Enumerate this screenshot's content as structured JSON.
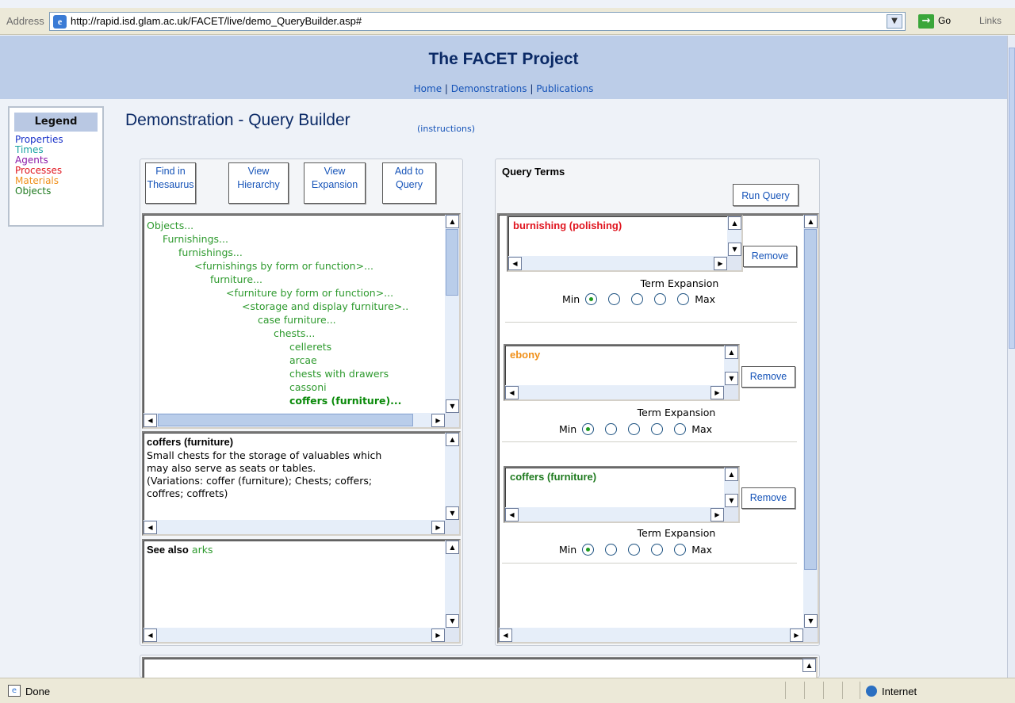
{
  "browser": {
    "address_label": "Address",
    "url": "http://rapid.isd.glam.ac.uk/FACET/live/demo_QueryBuilder.asp#",
    "go_label": "Go",
    "links_label": "Links",
    "status_text": "Done",
    "zone_text": "Internet"
  },
  "header": {
    "title": "The FACET Project",
    "nav": [
      "Home",
      "Demonstrations",
      "Publications"
    ],
    "separator": "|"
  },
  "legend": {
    "title": "Legend",
    "items": [
      {
        "label": "Properties",
        "color": "#1a33c9"
      },
      {
        "label": "Times",
        "color": "#19a3a3"
      },
      {
        "label": "Agents",
        "color": "#8a1aa8"
      },
      {
        "label": "Processes",
        "color": "#e0151f"
      },
      {
        "label": "Materials",
        "color": "#f0901a"
      },
      {
        "label": "Objects",
        "color": "#1f7a1f"
      }
    ]
  },
  "page": {
    "title": "Demonstration - Query Builder",
    "instructions_link": "(instructions)"
  },
  "toolbar": {
    "buttons": [
      {
        "line1": "Find in",
        "line2": "Thesaurus"
      },
      {
        "line1": "View",
        "line2": "Hierarchy"
      },
      {
        "line1": "View",
        "line2": "Expansion"
      },
      {
        "line1": "Add to",
        "line2": "Query"
      }
    ]
  },
  "hierarchy": {
    "lines": [
      "Objects...",
      "Furnishings...",
      "furnishings...",
      "<furnishings by form or function>...",
      "furniture...",
      "<furniture by form or function>...",
      "<storage and display furniture>..",
      "case furniture...",
      "chests...",
      "cellerets",
      "arcae",
      "chests with drawers",
      "cassoni",
      "coffers (furniture)..."
    ]
  },
  "definition": {
    "term": "coffers (furniture)",
    "text_lines": [
      "Small chests for the storage of valuables which",
      "may also serve as seats or tables.",
      "(Variations: coffer (furniture); Chests; coffers;",
      "coffres; coffrets)"
    ]
  },
  "see_also": {
    "label": "See also",
    "link": "arks"
  },
  "query": {
    "heading": "Query Terms",
    "run_label": "Run Query",
    "remove_label": "Remove",
    "expansion_label": "Term Expansion",
    "min_label": "Min",
    "max_label": "Max",
    "terms": [
      {
        "label": "burnishing (polishing)",
        "color": "#e0151f",
        "level": 1
      },
      {
        "label": "ebony",
        "color": "#f0901a",
        "level": 1
      },
      {
        "label": "coffers (furniture)",
        "color": "#1f7a1f",
        "level": 1
      }
    ]
  },
  "colors": {
    "header_bg": "#bccde8",
    "title_color": "#0b2a66",
    "link_color": "#1553b8",
    "tree_green": "#2e9a2e"
  }
}
